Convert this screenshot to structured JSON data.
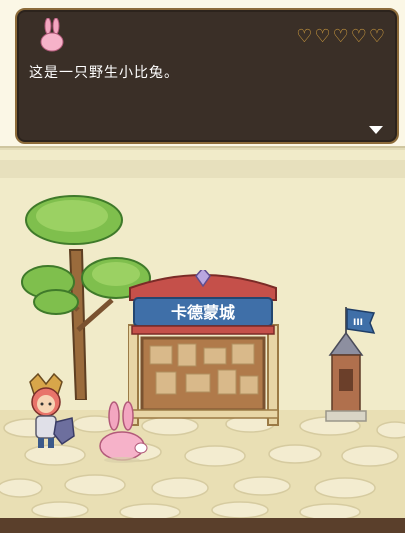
{
  "dialog": {
    "text": "这是一只野生小比兔。",
    "speaker_icon": "bunny-portrait-icon",
    "hearts_filled": 0,
    "hearts_total": 5,
    "heart_icon": "heart-outline-icon",
    "next_icon": "triangle-down-icon"
  },
  "scene": {
    "shop_sign": "卡德蒙城",
    "flag_icon": "castle-flag-icon"
  },
  "colors": {
    "dialog_bg": "#3a2f27",
    "dialog_border": "#8c6b3a",
    "heart": "#d9a441",
    "text": "#ffffff"
  }
}
